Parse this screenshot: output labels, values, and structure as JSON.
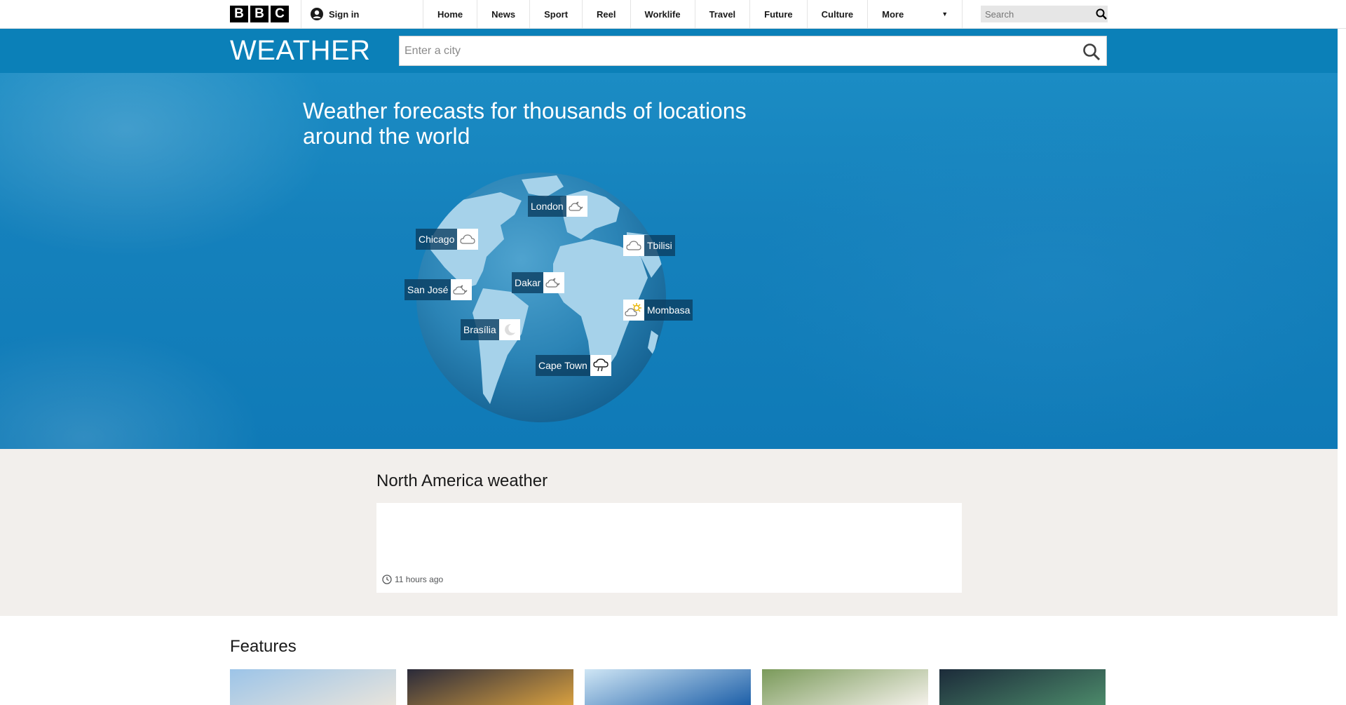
{
  "global_nav": {
    "logo_letters": [
      "B",
      "B",
      "C"
    ],
    "sign_in_label": "Sign in",
    "links": [
      {
        "label": "Home",
        "name": "nav-link-home"
      },
      {
        "label": "News",
        "name": "nav-link-news"
      },
      {
        "label": "Sport",
        "name": "nav-link-sport"
      },
      {
        "label": "Reel",
        "name": "nav-link-reel"
      },
      {
        "label": "Worklife",
        "name": "nav-link-worklife"
      },
      {
        "label": "Travel",
        "name": "nav-link-travel"
      },
      {
        "label": "Future",
        "name": "nav-link-future"
      },
      {
        "label": "Culture",
        "name": "nav-link-culture"
      }
    ],
    "more_label": "More",
    "search_placeholder": "Search"
  },
  "weather_header": {
    "title": "WEATHER",
    "search_placeholder": "Enter a city"
  },
  "hero": {
    "heading": "Weather forecasts for thousands of locations around the world",
    "cities": [
      {
        "name": "London",
        "icon": "cloud-moon-icon"
      },
      {
        "name": "Chicago",
        "icon": "cloud-icon"
      },
      {
        "name": "Tbilisi",
        "icon": "cloud-icon"
      },
      {
        "name": "San José",
        "icon": "cloud-moon-icon"
      },
      {
        "name": "Dakar",
        "icon": "cloud-moon-icon"
      },
      {
        "name": "Mombasa",
        "icon": "sun-cloud-icon"
      },
      {
        "name": "Brasília",
        "icon": "moon-icon"
      },
      {
        "name": "Cape Town",
        "icon": "rain-cloud-icon"
      }
    ]
  },
  "region": {
    "title": "North America weather",
    "timestamp": "11 hours ago"
  },
  "features": {
    "title": "Features",
    "cards": [
      {
        "name": "feature-card-building",
        "colors": [
          "#9cc4e8",
          "#e8e4dc"
        ]
      },
      {
        "name": "feature-card-globe-presenter",
        "colors": [
          "#2a2a3a",
          "#d8a040"
        ]
      },
      {
        "name": "feature-card-studio",
        "colors": [
          "#cfe6f5",
          "#1d5fa8"
        ]
      },
      {
        "name": "feature-card-blossom",
        "colors": [
          "#7a9a5a",
          "#f4f1ea"
        ]
      },
      {
        "name": "feature-card-aurora",
        "colors": [
          "#1c2b3a",
          "#4c8a6a"
        ]
      }
    ]
  },
  "colors": {
    "weather_blue": "#0b80b8",
    "panel_bg": "#f2efec"
  }
}
